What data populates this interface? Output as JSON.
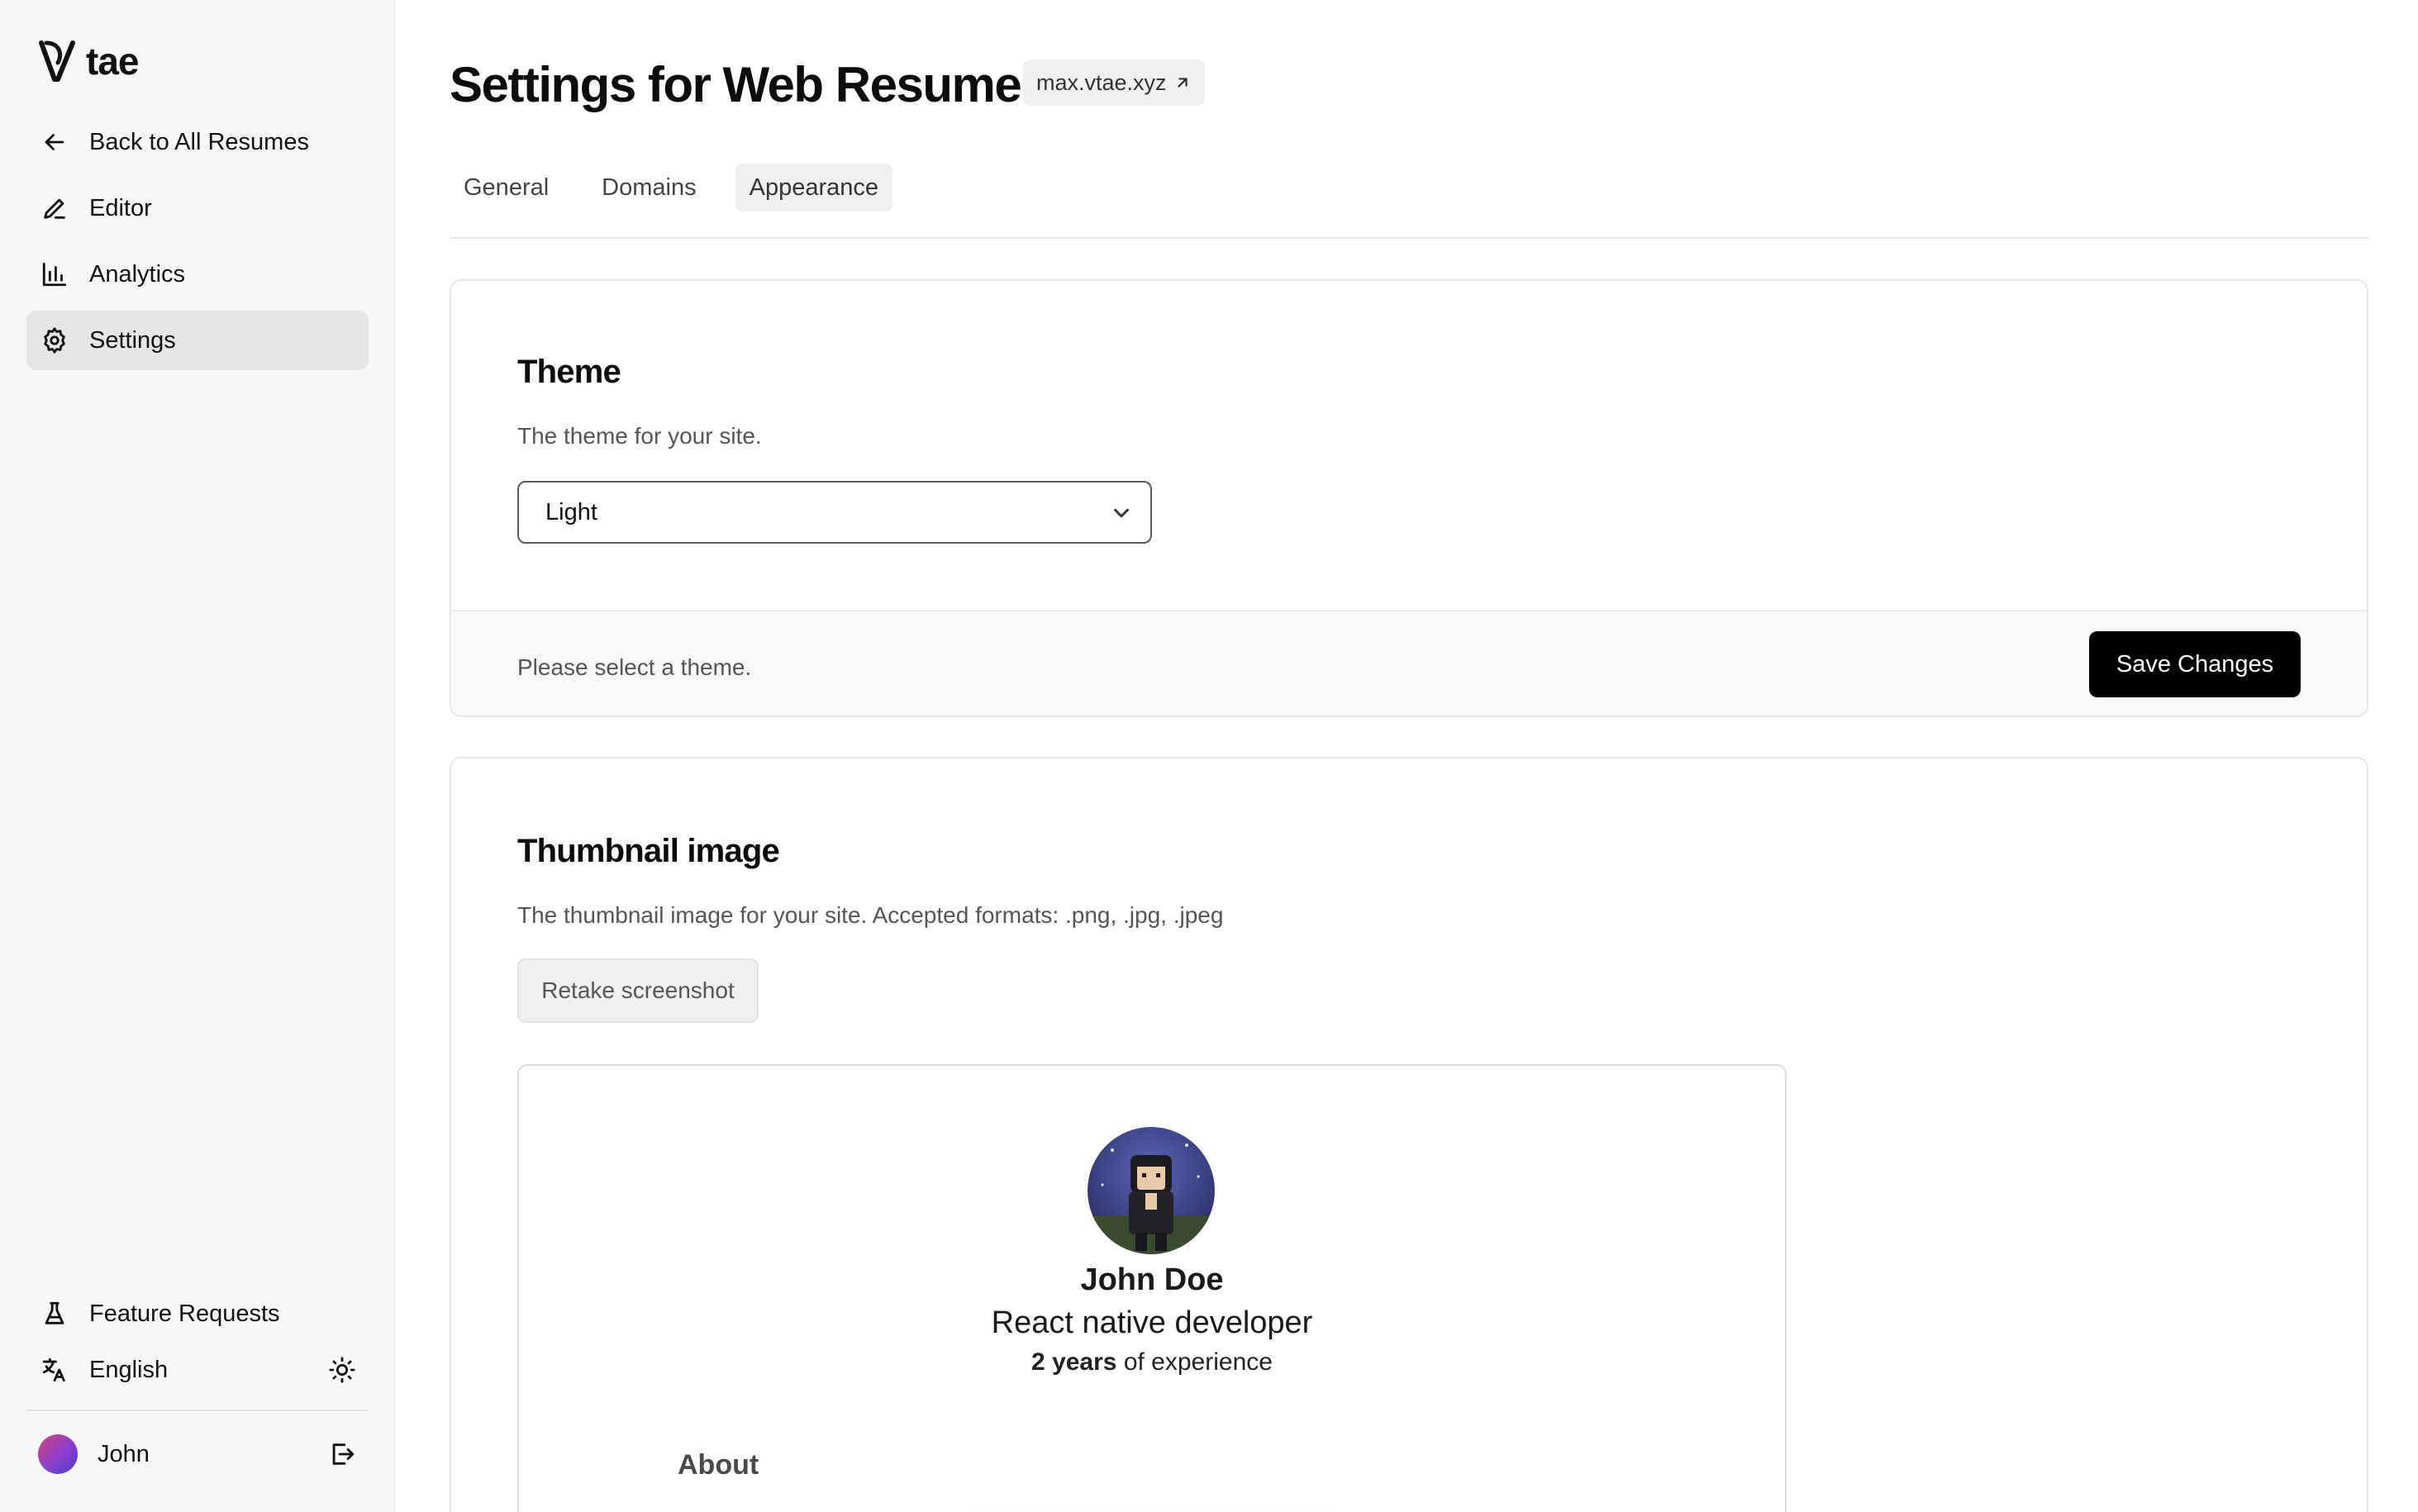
{
  "sidebar": {
    "brand": "Vtae",
    "nav": [
      {
        "label": "Back to All Resumes",
        "icon": "arrow-left-icon"
      },
      {
        "label": "Editor",
        "icon": "pencil-icon"
      },
      {
        "label": "Analytics",
        "icon": "bar-chart-icon"
      },
      {
        "label": "Settings",
        "icon": "gear-icon"
      }
    ],
    "feature_requests": {
      "label": "Feature Requests",
      "icon": "flask-icon"
    },
    "language": {
      "label": "English",
      "icon": "translate-icon"
    },
    "theme_toggle_icon": "sun-icon",
    "user": {
      "name": "John",
      "logout_icon": "logout-icon"
    }
  },
  "header": {
    "title": "Settings for Web Resume",
    "site_link": "max.vtae.xyz"
  },
  "tabs": [
    {
      "label": "General"
    },
    {
      "label": "Domains"
    },
    {
      "label": "Appearance"
    }
  ],
  "active_tab": "Appearance",
  "theme_card": {
    "title": "Theme",
    "description": "The theme for your site.",
    "selected_theme": "Light",
    "footer_hint": "Please select a theme.",
    "save_label": "Save Changes"
  },
  "thumbnail_card": {
    "title": "Thumbnail image",
    "description": "The thumbnail image for your site. Accepted formats: .png, .jpg, .jpeg",
    "retake_label": "Retake screenshot",
    "preview": {
      "name": "John Doe",
      "role": "React native developer",
      "experience_bold": "2 years",
      "experience_rest": " of experience",
      "section": "About"
    }
  },
  "colors": {
    "sidebar_bg": "#f7f7f7",
    "active_nav_bg": "#e6e6e6",
    "primary_button": "#000000",
    "accent_avatar": "#8a3fd1"
  }
}
